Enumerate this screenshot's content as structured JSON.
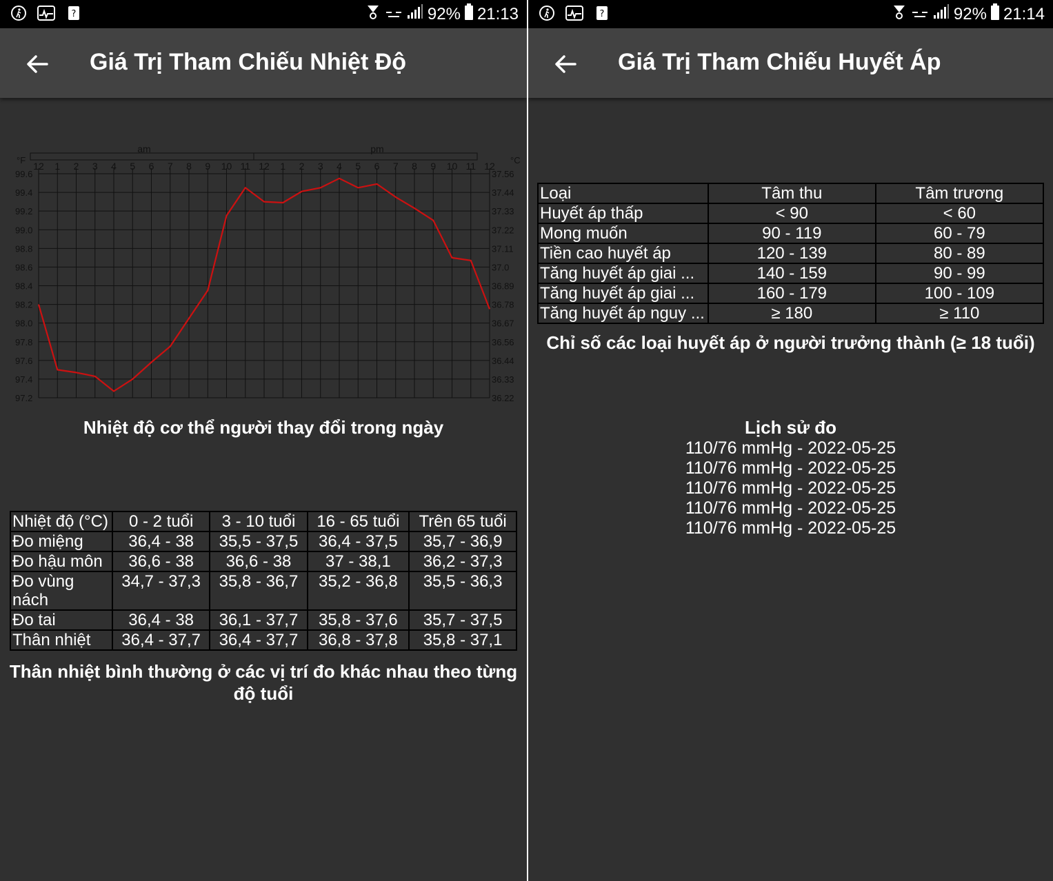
{
  "left": {
    "status": {
      "battery": "92%",
      "time": "21:13"
    },
    "title": "Giá Trị Tham Chiếu Nhiệt Độ",
    "chart_data": {
      "type": "line",
      "title": "",
      "top_labels": {
        "am": "am",
        "pm": "pm"
      },
      "unit_left": "°F",
      "unit_right": "°C",
      "hour_labels": [
        "12",
        "1",
        "2",
        "3",
        "4",
        "5",
        "6",
        "7",
        "8",
        "9",
        "10",
        "11",
        "12",
        "1",
        "2",
        "3",
        "4",
        "5",
        "6",
        "7",
        "8",
        "9",
        "10",
        "11",
        "12"
      ],
      "y_left_ticks": [
        "99.6",
        "99.4",
        "99.2",
        "99.0",
        "98.8",
        "98.6",
        "98.4",
        "98.2",
        "98.0",
        "97.8",
        "97.6",
        "97.4",
        "97.2"
      ],
      "y_right_ticks": [
        "37.56",
        "37.44",
        "37.33",
        "37.22",
        "37.11",
        "37.0",
        "36.89",
        "36.78",
        "36.67",
        "36.56",
        "36.44",
        "36.33",
        "36.22"
      ],
      "ylim": [
        97.2,
        99.6
      ],
      "series": [
        {
          "color": "#cc1111",
          "values": [
            98.2,
            97.5,
            97.47,
            97.43,
            97.27,
            97.4,
            97.58,
            97.75,
            98.05,
            98.35,
            99.15,
            99.45,
            99.3,
            99.29,
            99.41,
            99.45,
            99.55,
            99.45,
            99.49,
            99.35,
            99.23,
            99.1,
            98.7,
            98.67,
            98.15
          ]
        }
      ],
      "grid": true
    },
    "chart_caption": "Nhiệt độ cơ thể người thay đổi trong ngày",
    "temp_table": {
      "header": [
        "Nhiệt độ (°C)",
        "0 - 2 tuổi",
        "3 - 10 tuổi",
        "16 - 65 tuổi",
        "Trên 65 tuổi"
      ],
      "rows": [
        [
          "Đo miệng",
          "36,4 - 38",
          "35,5 - 37,5",
          "36,4 - 37,5",
          "35,7 - 36,9"
        ],
        [
          "Đo hậu môn",
          "36,6 - 38",
          "36,6 - 38",
          "37 - 38,1",
          "36,2 - 37,3"
        ],
        [
          "Đo vùng nách",
          "34,7 - 37,3",
          "35,8 - 36,7",
          "35,2 - 36,8",
          "35,5 - 36,3"
        ],
        [
          "Đo tai",
          "36,4 - 38",
          "36,1 - 37,7",
          "35,8 - 37,6",
          "35,7 - 37,5"
        ],
        [
          "Thân nhiệt",
          "36,4 - 37,7",
          "36,4 - 37,7",
          "36,8 - 37,8",
          "35,8 - 37,1"
        ]
      ]
    },
    "table_caption": "Thân nhiệt bình thường ở các vị trí đo khác nhau theo từng độ tuổi"
  },
  "right": {
    "status": {
      "battery": "92%",
      "time": "21:14"
    },
    "title": "Giá Trị Tham Chiếu Huyết Áp",
    "bp_table": {
      "header": [
        "Loại",
        "Tâm thu",
        "Tâm trương"
      ],
      "rows": [
        [
          "Huyết áp thấp",
          "< 90",
          "< 60"
        ],
        [
          "Mong muốn",
          "90 - 119",
          "60 - 79"
        ],
        [
          "Tiền cao huyết áp",
          "120 - 139",
          "80 - 89"
        ],
        [
          "Tăng huyết áp giai ...",
          "140 - 159",
          "90 - 99"
        ],
        [
          "Tăng huyết áp giai ...",
          "160 - 179",
          "100 - 109"
        ],
        [
          "Tăng huyết áp nguy ...",
          "≥ 180",
          "≥ 110"
        ]
      ]
    },
    "bp_caption": "Chỉ số các loại huyết áp ở người trưởng thành (≥ 18 tuổi)",
    "history_title": "Lịch sử đo",
    "history": [
      "110/76 mmHg - 2022-05-25",
      "110/76 mmHg - 2022-05-25",
      "110/76 mmHg - 2022-05-25",
      "110/76 mmHg - 2022-05-25",
      "110/76 mmHg - 2022-05-25"
    ]
  }
}
